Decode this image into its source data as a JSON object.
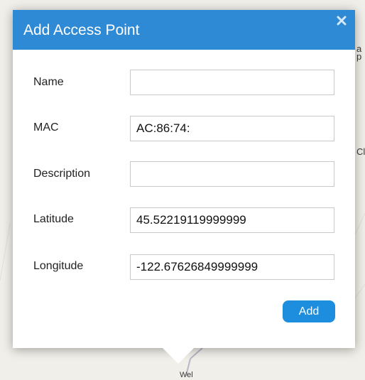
{
  "popup": {
    "title": "Add Access Point",
    "close_icon": "close-icon",
    "fields": [
      {
        "label": "Name",
        "value": "",
        "placeholder": ""
      },
      {
        "label": "MAC",
        "value": "AC:86:74:",
        "placeholder": ""
      },
      {
        "label": "Description",
        "value": "",
        "placeholder": ""
      },
      {
        "label": "Latitude",
        "value": "45.52219119999999",
        "placeholder": ""
      },
      {
        "label": "Longitude",
        "value": "-122.67626849999999",
        "placeholder": ""
      }
    ],
    "add_label": "Add"
  },
  "map": {
    "labels": {
      "right_top": "a\np",
      "right_mid": "Cl",
      "bottom": "Wel ... d"
    }
  },
  "colors": {
    "header": "#2f8ad6",
    "add_button": "#1d8ede",
    "map_background": "#f1efe9"
  }
}
